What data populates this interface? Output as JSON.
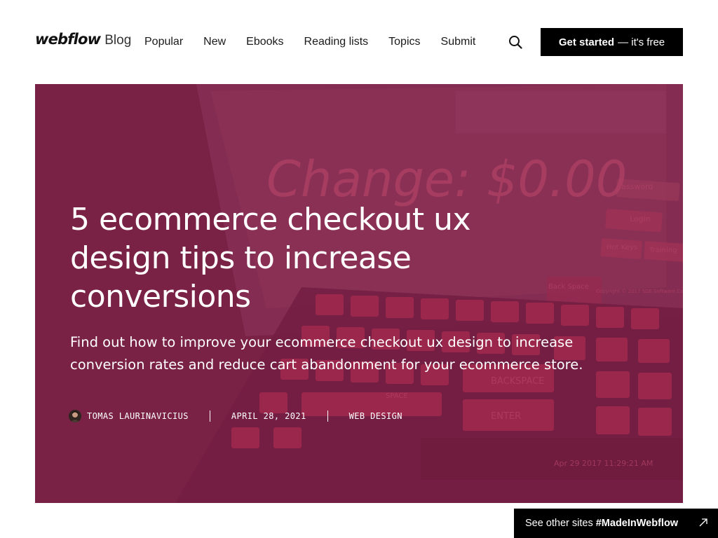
{
  "header": {
    "logo": "webflow",
    "logo_suffix": "Blog",
    "nav": [
      "Popular",
      "New",
      "Ebooks",
      "Reading lists",
      "Topics",
      "Submit"
    ],
    "search_icon": "search-icon",
    "cta_bold": "Get started",
    "cta_rest": "— it's free"
  },
  "hero": {
    "title": "5 ecommerce checkout ux design tips to increase conversions",
    "subtitle": "Find out how to improve your ecommerce checkout ux design to increase conversion rates and reduce cart abandonment for your ecommerce store.",
    "author": "TOMAS LAURINAVICIUS",
    "date": "APRIL 28, 2021",
    "category": "WEB DESIGN",
    "overlay_color": "#7d2446",
    "background_text": {
      "change": "Change: $0.00",
      "password": "Password",
      "login": "Login",
      "hot_keys": "Hot Keys",
      "training": "Training",
      "backspace_key": "Back Space",
      "copyright": "Copyright © 2017 SDE Software Corporation All Rights Reserved",
      "space": "SPACE",
      "backspace": "BACKSPACE",
      "enter": "ENTER",
      "timestamp": "Apr 29 2017 11:29:21 AM"
    }
  },
  "badge": {
    "text": "See other sites",
    "tag": "#MadeInWebflow",
    "icon": "arrow-up-right-icon"
  }
}
